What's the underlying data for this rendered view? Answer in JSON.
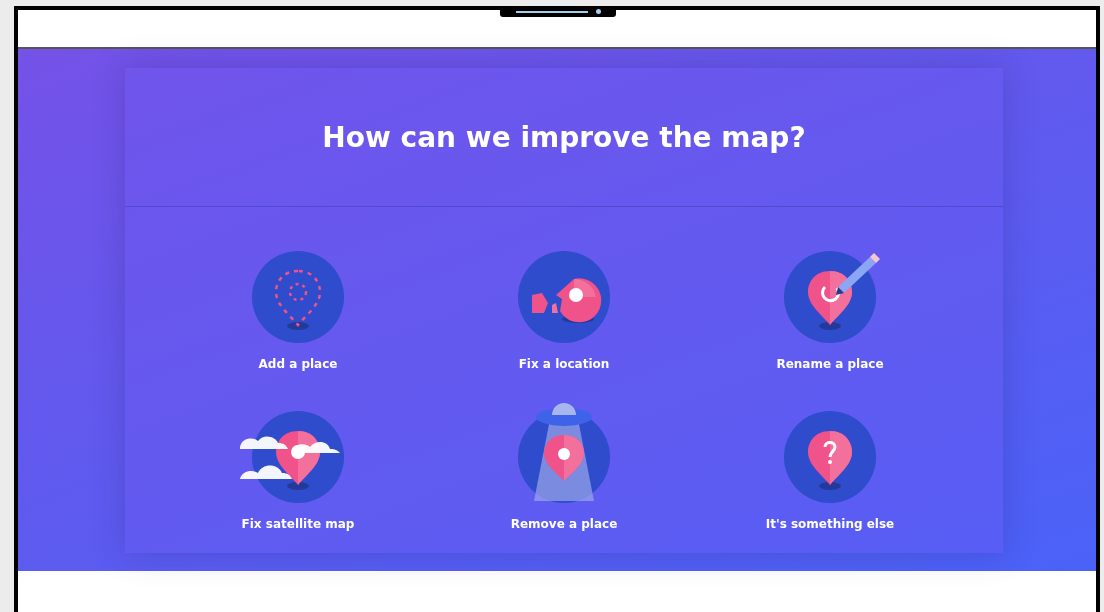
{
  "panel": {
    "title": "How can we improve the map?"
  },
  "options": [
    {
      "kind": "add",
      "label": "Add a place"
    },
    {
      "kind": "move",
      "label": "Fix a location"
    },
    {
      "kind": "rename",
      "label": "Rename a place"
    },
    {
      "kind": "satellite",
      "label": "Fix satellite map"
    },
    {
      "kind": "remove",
      "label": "Remove a place"
    },
    {
      "kind": "other",
      "label": "It's something else"
    }
  ]
}
